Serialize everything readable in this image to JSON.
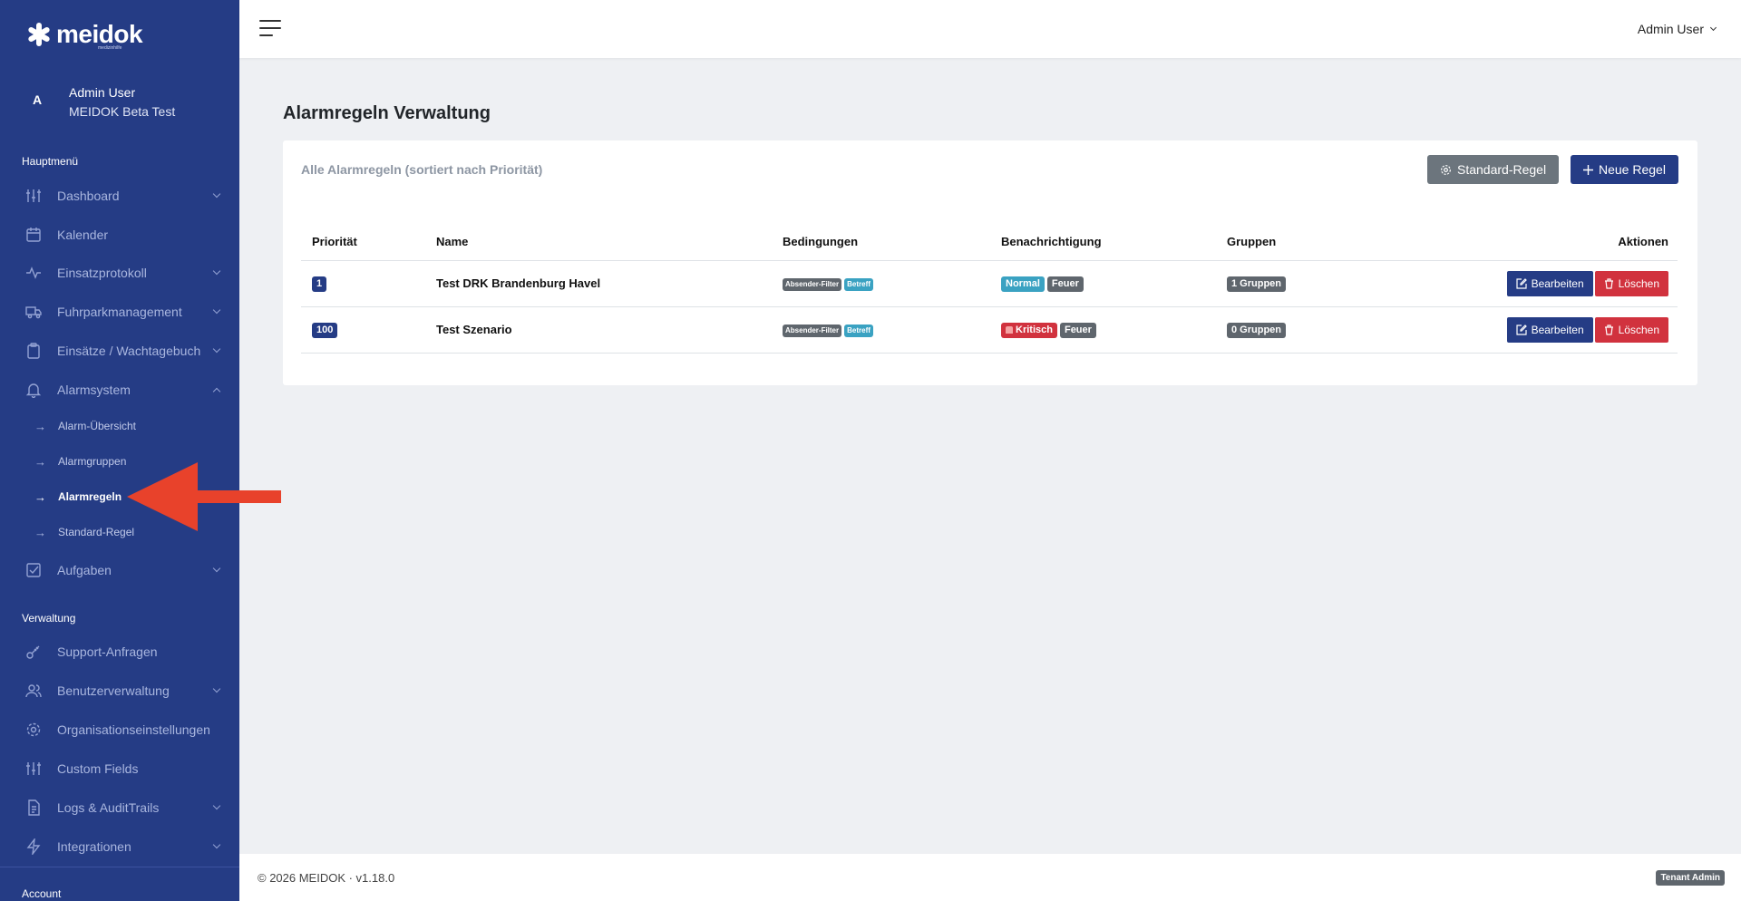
{
  "brand": {
    "name": "meidok",
    "sub": "medizinhilfe"
  },
  "user": {
    "initial": "A",
    "name": "Admin User",
    "org": "MEIDOK Beta Test"
  },
  "sidebar": {
    "main_title": "Hauptmenü",
    "admin_title": "Verwaltung",
    "account_title": "Account",
    "main_items": [
      {
        "label": "Dashboard",
        "icon": "sliders-icon",
        "has_children": true
      },
      {
        "label": "Kalender",
        "icon": "calendar-icon",
        "has_children": false
      },
      {
        "label": "Einsatzprotokoll",
        "icon": "activity-icon",
        "has_children": true
      },
      {
        "label": "Fuhrparkmanagement",
        "icon": "truck-icon",
        "has_children": true
      },
      {
        "label": "Einsätze / Wachtagebuch",
        "icon": "clipboard-icon",
        "has_children": true
      },
      {
        "label": "Alarmsystem",
        "icon": "bell-icon",
        "has_children": true,
        "expanded": true
      }
    ],
    "alarm_sub": [
      {
        "label": "Alarm-Übersicht"
      },
      {
        "label": "Alarmgruppen"
      },
      {
        "label": "Alarmregeln",
        "active": true
      },
      {
        "label": "Standard-Regel"
      }
    ],
    "tasks": {
      "label": "Aufgaben",
      "icon": "check-square-icon"
    },
    "admin_items": [
      {
        "label": "Support-Anfragen",
        "icon": "key-icon",
        "has_children": false
      },
      {
        "label": "Benutzerverwaltung",
        "icon": "users-icon",
        "has_children": true
      },
      {
        "label": "Organisationseinstellungen",
        "icon": "gear-icon",
        "has_children": false
      },
      {
        "label": "Custom Fields",
        "icon": "sliders-icon",
        "has_children": false
      },
      {
        "label": "Logs & AuditTrails",
        "icon": "file-text-icon",
        "has_children": true
      },
      {
        "label": "Integrationen",
        "icon": "zap-icon",
        "has_children": true
      }
    ]
  },
  "topbar": {
    "user_label": "Admin User"
  },
  "page": {
    "title_bold": "Alarmregeln",
    "title_rest": " Verwaltung",
    "card_title": "Alle Alarmregeln (sortiert nach Priorität)",
    "btn_default_rule": "Standard-Regel",
    "btn_new_rule": "Neue Regel"
  },
  "table": {
    "headers": [
      "Priorität",
      "Name",
      "Bedingungen",
      "Benachrichtigung",
      "Gruppen",
      "Aktionen"
    ],
    "rows": [
      {
        "priority": "1",
        "name": "Test DRK Brandenburg Havel",
        "conditions": [
          "Absender-Filter",
          "Betreff"
        ],
        "notify_level": "Normal",
        "notify_type": "Feuer",
        "groups": "1 Gruppen",
        "edit": "Bearbeiten",
        "delete": "Löschen"
      },
      {
        "priority": "100",
        "name": "Test Szenario",
        "conditions": [
          "Absender-Filter",
          "Betreff"
        ],
        "notify_level": "Kritisch",
        "notify_type": "Feuer",
        "groups": "0 Gruppen",
        "edit": "Bearbeiten",
        "delete": "Löschen"
      }
    ]
  },
  "footer": {
    "copyright": "© 2026 MEIDOK · v1.18.0",
    "role_badge": "Tenant Admin"
  },
  "colors": {
    "sidebar": "#253c85",
    "primary": "#253c85",
    "danger": "#d1323e",
    "info": "#3aa2c2",
    "secondary": "#6c757d",
    "annotation": "#e8422b"
  }
}
